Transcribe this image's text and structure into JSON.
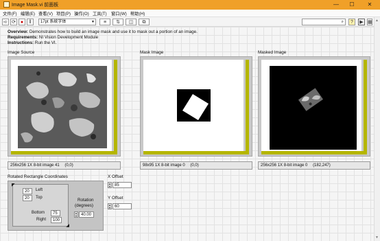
{
  "window": {
    "title": "Image Mask.vi 前面板",
    "minimize_glyph": "—",
    "maximize_glyph": "☐",
    "close_glyph": "✕"
  },
  "menu": {
    "items": [
      "文件(F)",
      "编辑(E)",
      "查看(V)",
      "项目(P)",
      "操作(O)",
      "工具(T)",
      "窗口(W)",
      "帮助(H)"
    ]
  },
  "toolbar": {
    "font_select": "17pt 系统字体",
    "help_glyph": "?"
  },
  "description": {
    "overview_label": "Overview:",
    "overview_text": "Demonstrates how to build an image mask and use it to mask out a portion of an image.",
    "requirements_label": "Requirements:",
    "requirements_text": "NI Vision Development Module",
    "instructions_label": "Instructions:",
    "instructions_text": "Run the VI."
  },
  "image_source": {
    "label": "Image Source",
    "info": "256x256 1X 8-bit image 41",
    "coords": "(0,0)"
  },
  "mask_image": {
    "label": "Mask Image",
    "info": "98x95 1X 8-bit image 0",
    "coords": "(0,0)"
  },
  "masked_image": {
    "label": "Masked Image",
    "info": "256x256 1X 8-bit image 0",
    "coords": "(182,247)"
  },
  "rect_coords": {
    "label": "Rotated Rectangle Coordinates",
    "left_label": "Left",
    "top_label": "Top",
    "bottom_label": "Bottom",
    "right_label": "Right",
    "rotation_label": "Rotation",
    "rotation_unit": "(degrees)",
    "left": "20",
    "top": "20",
    "bottom": "75",
    "right": "100",
    "rotation": "40.00"
  },
  "offsets": {
    "x_label": "X Offset",
    "x_value": "85",
    "y_label": "Y Offset",
    "y_value": "60"
  },
  "colors": {
    "title_bar": "#f0a028",
    "scrollbar_accent": "#b5b600"
  }
}
